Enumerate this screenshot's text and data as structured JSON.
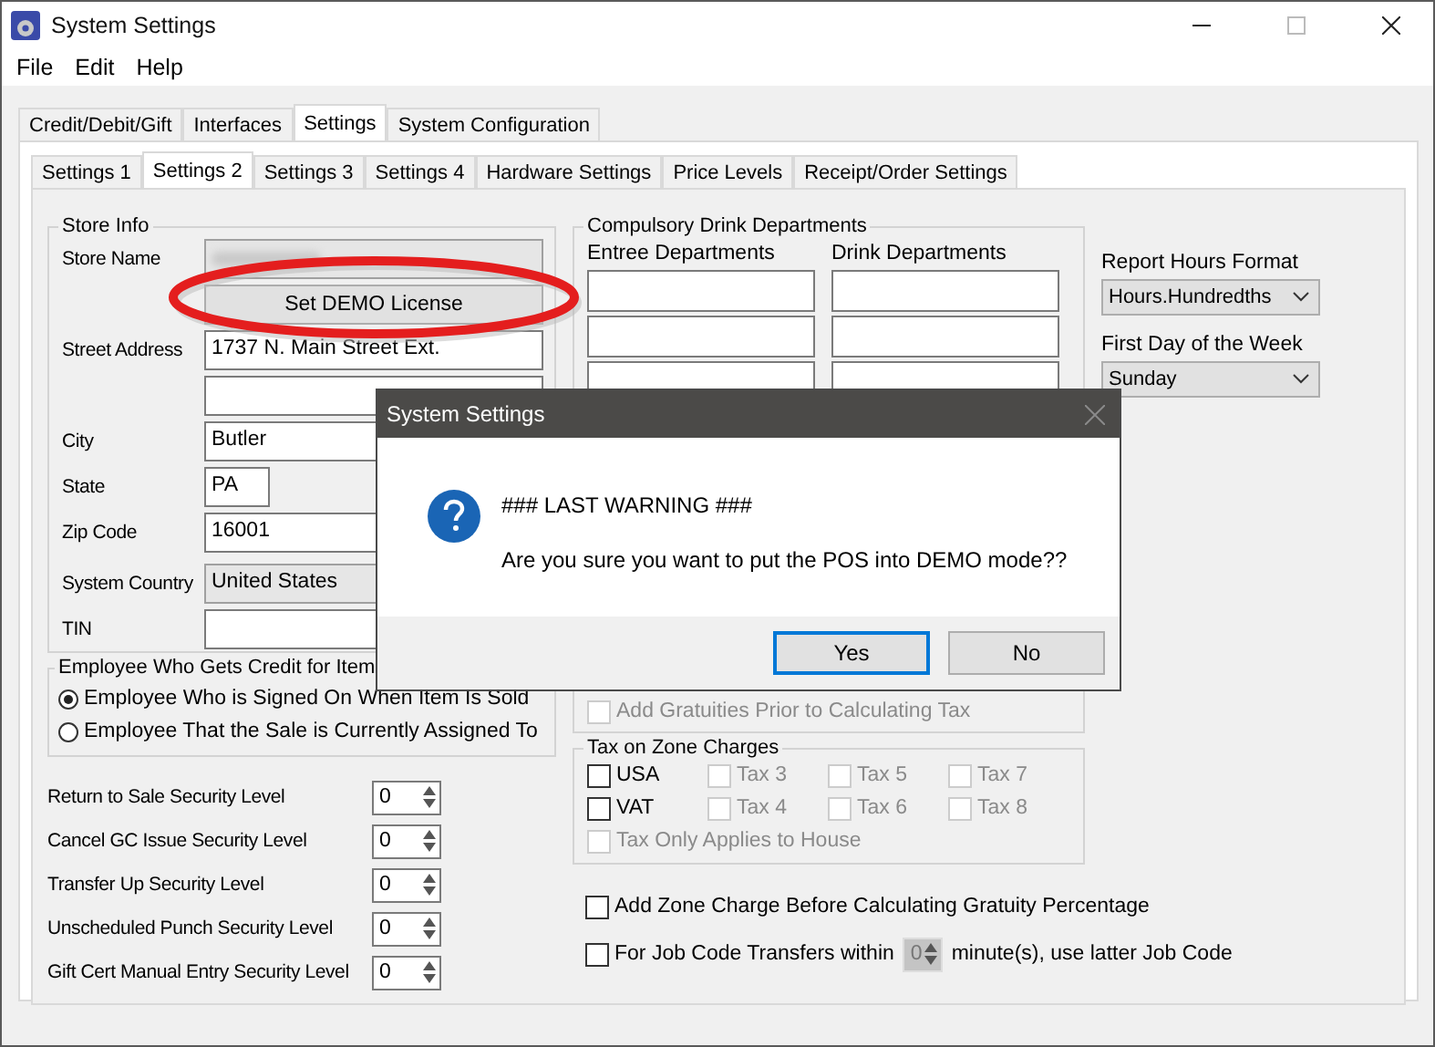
{
  "window": {
    "title": "System Settings"
  },
  "menu": [
    "File",
    "Edit",
    "Help"
  ],
  "tabs": [
    {
      "label": "Credit/Debit/Gift",
      "selected": false
    },
    {
      "label": "Interfaces",
      "selected": false
    },
    {
      "label": "Settings",
      "selected": true
    },
    {
      "label": "System Configuration",
      "selected": false
    }
  ],
  "subtabs": [
    {
      "label": "Settings 1",
      "selected": false
    },
    {
      "label": "Settings 2",
      "selected": true
    },
    {
      "label": "Settings 3",
      "selected": false
    },
    {
      "label": "Settings 4",
      "selected": false
    },
    {
      "label": "Hardware Settings",
      "selected": false
    },
    {
      "label": "Price Levels",
      "selected": false
    },
    {
      "label": "Receipt/Order Settings",
      "selected": false
    }
  ],
  "store_info": {
    "title": "Store Info",
    "rows": [
      {
        "kind": "blurred",
        "label": "Store Name"
      },
      {
        "kind": "button",
        "label": "Set DEMO License"
      },
      {
        "kind": "text",
        "label": "Street Address",
        "value": "1737 N. Main Street Ext."
      },
      {
        "kind": "text"
      },
      {
        "kind": "text",
        "label": "City",
        "value": "Butler"
      },
      {
        "kind": "short",
        "label": "State",
        "value": "PA"
      },
      {
        "kind": "text",
        "label": "Zip Code",
        "value": "16001"
      },
      {
        "kind": "combo",
        "label": "System Country",
        "value": "United States"
      },
      {
        "kind": "text",
        "label": "TIN"
      }
    ]
  },
  "employee_credit": {
    "title": "Employee Who Gets Credit for Item",
    "options": [
      {
        "label": "Employee Who is Signed On When Item Is Sold",
        "selected": true
      },
      {
        "label": "Employee That the Sale is Currently Assigned To",
        "selected": false
      }
    ]
  },
  "security_levels": [
    {
      "label": "Return to Sale Security Level",
      "value": "0"
    },
    {
      "label": "Cancel GC Issue Security Level",
      "value": "0"
    },
    {
      "label": "Transfer Up Security Level",
      "value": "0"
    },
    {
      "label": "Unscheduled Punch Security Level",
      "value": "0"
    },
    {
      "label": "Gift Cert Manual Entry Security Level",
      "value": "0"
    }
  ],
  "compulsory_drink": {
    "title": "Compulsory Drink Departments",
    "columns": [
      "Entree Departments",
      "Drink Departments"
    ]
  },
  "gratuity": {
    "label": "Add Gratuities Prior to Calculating Tax",
    "checked": false,
    "disabled": true
  },
  "tax_on_zone": {
    "title": "Tax on Zone Charges",
    "items": [
      {
        "label": "USA",
        "checked": false,
        "disabled": false
      },
      {
        "label": "Tax 3",
        "checked": false,
        "disabled": true
      },
      {
        "label": "Tax 5",
        "checked": false,
        "disabled": true
      },
      {
        "label": "Tax 7",
        "checked": false,
        "disabled": true
      },
      {
        "label": "VAT",
        "checked": false,
        "disabled": false
      },
      {
        "label": "Tax 4",
        "checked": false,
        "disabled": true
      },
      {
        "label": "Tax 6",
        "checked": false,
        "disabled": true
      },
      {
        "label": "Tax 8",
        "checked": false,
        "disabled": true
      }
    ],
    "house": {
      "label": "Tax Only Applies to House",
      "checked": false,
      "disabled": true
    }
  },
  "options": [
    {
      "kind": "checkbox",
      "label": "Add Zone Charge Before Calculating Gratuity Percentage",
      "checked": false
    },
    {
      "kind": "spin",
      "label": "For Job Code Transfers within",
      "value": "0",
      "suffix": "minute(s), use latter Job Code",
      "checked": false
    }
  ],
  "report_hours": {
    "label": "Report Hours Format",
    "value": "Hours.Hundredths"
  },
  "first_day": {
    "label": "First Day of the Week",
    "value": "Sunday"
  },
  "dialog": {
    "title": "System Settings",
    "heading": "### LAST WARNING ###",
    "message": "Are you sure you want to put the POS into DEMO mode??",
    "buttons": [
      {
        "label": "Yes",
        "default": true
      },
      {
        "label": "No",
        "default": false
      }
    ]
  }
}
